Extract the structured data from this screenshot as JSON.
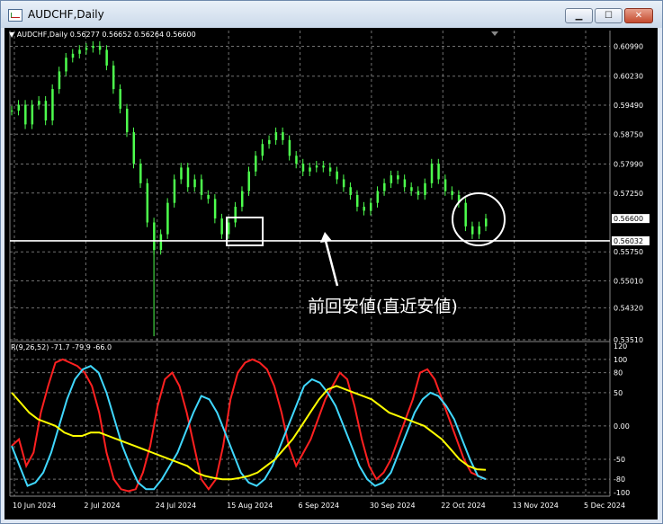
{
  "window": {
    "title": "AUDCHF,Daily",
    "min_label": "▁",
    "max_label": "☐",
    "close_label": "✕"
  },
  "chart_header": "▼ AUDCHF,Daily  0.56277 0.56652 0.56264 0.56600",
  "indicator_header": "R(9,26,52) -71.7 -79.9 -66.0",
  "annotation_label": "前回安値(直近安値)",
  "colors": {
    "candle": "#4dff4d",
    "support_line": "#ffffff",
    "red_line": "#ff2020",
    "cyan_line": "#40d8ff",
    "yellow_line": "#ffff00",
    "grid": "#a0a0a0"
  },
  "chart_data": [
    {
      "type": "candlestick",
      "title": "AUDCHF,Daily",
      "ohlc_last": {
        "open": 0.56277,
        "high": 0.56652,
        "low": 0.56264,
        "close": 0.566
      },
      "y_ticks": [
        "0.60990",
        "0.60230",
        "0.59490",
        "0.58750",
        "0.57990",
        "0.57250",
        "0.56600",
        "0.56032",
        "0.55750",
        "0.55010",
        "0.54320",
        "0.53510"
      ],
      "y_tick_values": [
        0.6099,
        0.6023,
        0.5949,
        0.5875,
        0.5799,
        0.5725,
        0.566,
        0.56032,
        0.5575,
        0.5501,
        0.5432,
        0.5351
      ],
      "ylim": [
        0.5351,
        0.613
      ],
      "x_ticks": [
        "10 Jun 2024",
        "2 Jul 2024",
        "24 Jul 2024",
        "15 Aug 2024",
        "6 Sep 2024",
        "30 Sep 2024",
        "22 Oct 2024",
        "13 Nov 2024",
        "5 Dec 2024"
      ],
      "support_level": 0.56032,
      "close_series": [
        0.5935,
        0.595,
        0.59,
        0.595,
        0.596,
        0.591,
        0.599,
        0.6035,
        0.607,
        0.608,
        0.609,
        0.6095,
        0.61,
        0.609,
        0.605,
        0.599,
        0.594,
        0.588,
        0.58,
        0.575,
        0.565,
        0.558,
        0.562,
        0.57,
        0.576,
        0.579,
        0.574,
        0.576,
        0.572,
        0.571,
        0.566,
        0.562,
        0.565,
        0.569,
        0.573,
        0.578,
        0.582,
        0.585,
        0.586,
        0.588,
        0.586,
        0.582,
        0.58,
        0.578,
        0.579,
        0.5795,
        0.579,
        0.578,
        0.576,
        0.574,
        0.572,
        0.569,
        0.568,
        0.57,
        0.573,
        0.575,
        0.577,
        0.576,
        0.574,
        0.573,
        0.572,
        0.575,
        0.58,
        0.576,
        0.573,
        0.572,
        0.57,
        0.564,
        0.562,
        0.564,
        0.566
      ]
    },
    {
      "type": "line",
      "title": "R(9,26,52)",
      "y_ticks": [
        "120",
        "100",
        "80",
        "50",
        "0.00",
        "-50",
        "-80",
        "-100"
      ],
      "y_tick_values": [
        120,
        100,
        80,
        50,
        0,
        -50,
        -80,
        -100
      ],
      "ylim": [
        -100,
        120
      ],
      "last_values": [
        -71.7,
        -79.9,
        -66.0
      ],
      "series": [
        {
          "color": "red",
          "values": [
            -30,
            -20,
            -60,
            -40,
            20,
            60,
            95,
            100,
            95,
            90,
            80,
            60,
            20,
            -40,
            -80,
            -95,
            -98,
            -95,
            -70,
            -30,
            30,
            70,
            80,
            60,
            20,
            -30,
            -80,
            -95,
            -80,
            -30,
            40,
            80,
            95,
            100,
            95,
            85,
            60,
            20,
            -30,
            -60,
            -40,
            -20,
            10,
            40,
            60,
            80,
            70,
            30,
            -20,
            -60,
            -80,
            -70,
            -50,
            -20,
            10,
            40,
            80,
            85,
            70,
            40,
            10,
            -20,
            -50,
            -70,
            -75,
            -80
          ]
        },
        {
          "color": "cyan",
          "values": [
            -30,
            -60,
            -90,
            -85,
            -70,
            -40,
            0,
            40,
            70,
            85,
            90,
            80,
            50,
            10,
            -30,
            -60,
            -85,
            -95,
            -95,
            -80,
            -60,
            -40,
            -10,
            20,
            45,
            40,
            20,
            -10,
            -40,
            -70,
            -85,
            -90,
            -80,
            -60,
            -30,
            0,
            30,
            60,
            70,
            65,
            50,
            30,
            0,
            -30,
            -60,
            -80,
            -90,
            -85,
            -70,
            -40,
            -10,
            20,
            40,
            50,
            45,
            30,
            10,
            -20,
            -50,
            -75,
            -80
          ]
        },
        {
          "color": "yellow",
          "values": [
            50,
            35,
            20,
            10,
            5,
            0,
            -10,
            -15,
            -15,
            -10,
            -10,
            -15,
            -20,
            -25,
            -30,
            -35,
            -40,
            -45,
            -50,
            -55,
            -60,
            -70,
            -75,
            -78,
            -80,
            -80,
            -78,
            -75,
            -70,
            -60,
            -50,
            -35,
            -20,
            0,
            20,
            40,
            55,
            60,
            55,
            50,
            45,
            40,
            30,
            20,
            15,
            10,
            5,
            0,
            -10,
            -20,
            -35,
            -50,
            -60,
            -65,
            -66
          ]
        }
      ]
    }
  ]
}
